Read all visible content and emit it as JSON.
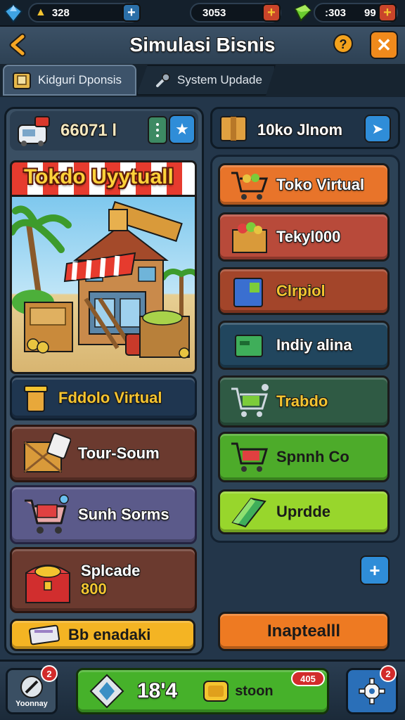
{
  "topbar": {
    "res1_value": "328",
    "res2_value": "3053",
    "res3_value": ":303",
    "res3b_value": "99",
    "plus_label": "+"
  },
  "header": {
    "title": "Simulasi Bisnis",
    "back_icon": "arrow-left-icon",
    "close_label": "✕"
  },
  "tabs": [
    {
      "label": "Kidguri Dponsis",
      "active": true
    },
    {
      "label": "System Updade",
      "active": false
    }
  ],
  "left": {
    "money_value": "66071 l",
    "shop_banner": "Tokdo Uyytuall",
    "shop_name": "Fddolo Virtual",
    "items": [
      {
        "label": "Tour-Soum"
      },
      {
        "label": "Sunh Sorms"
      },
      {
        "label": "Splcade",
        "value": "800"
      }
    ],
    "bottom_button": "Bb enadaki"
  },
  "right": {
    "header_label": "10ko Jlnom",
    "buttons": [
      {
        "label": "Toko Virtual",
        "color": "#e8742a"
      },
      {
        "label": "Tekyl000",
        "color": "#b84a3a"
      },
      {
        "label": "Clrpiol",
        "color": "#a3452a"
      },
      {
        "label": "Indiy alina",
        "color": "#21465e"
      },
      {
        "label": "Trabdo",
        "color": "#2f5a44"
      },
      {
        "label": "Spnnh Co",
        "color": "#4dab2a"
      },
      {
        "label": "Uprdde",
        "color": "#98d62c"
      }
    ],
    "install_button": "Inaptealll"
  },
  "bottom": {
    "left_label": "Yoonnay",
    "left_badge": "2",
    "center_value": "18'4",
    "center_coin_label": "stoon",
    "center_badge": "405",
    "right_badge": "2"
  },
  "colors": {
    "accent_orange": "#f08a1c",
    "accent_blue": "#3a9be0",
    "gold": "#f4c430"
  }
}
